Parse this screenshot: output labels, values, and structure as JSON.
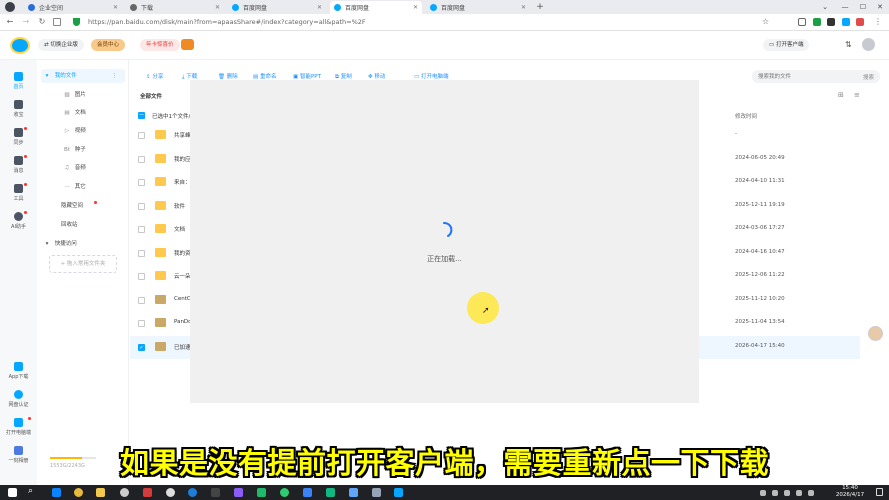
{
  "browser": {
    "tabs": [
      {
        "label": "企业空间",
        "color": "#2b6cd6",
        "active": false
      },
      {
        "label": "下载",
        "color": "#555555",
        "active": false
      },
      {
        "label": "百度网盘",
        "color": "#06a7ff",
        "active": false
      },
      {
        "label": "百度网盘",
        "color": "#06a7ff",
        "active": true
      },
      {
        "label": "百度网盘",
        "color": "#06a7ff",
        "active": false
      }
    ],
    "url": "https://pan.baidu.com/disk/main?from=apaasShare#/index?category=all&path=%2F"
  },
  "header": {
    "switch_enterprise": "切换企业版",
    "member_center": "会员中心",
    "promo": "年卡惊喜价",
    "open_client": "打开客户端"
  },
  "rail": {
    "items": [
      "首页",
      "收宝",
      "同步",
      "消息",
      "工具",
      "AI助手"
    ],
    "bottom": [
      "App下载",
      "网盘认证",
      "打开电脑端",
      "一刻相册"
    ]
  },
  "sidenav": {
    "my_files": "我的文件",
    "categories": [
      {
        "icon": "▨",
        "label": "图片"
      },
      {
        "icon": "▤",
        "label": "文档"
      },
      {
        "icon": "▷",
        "label": "视频"
      },
      {
        "icon": "Bt",
        "label": "种子"
      },
      {
        "icon": "♫",
        "label": "音频"
      },
      {
        "icon": "···",
        "label": "其它"
      }
    ],
    "hidden_space": "隐藏空间",
    "recycle_bin": "回收站",
    "quick_access": "快捷访问",
    "add_folder": "+ 拖入常用文件夹",
    "storage": "1553G/2243G"
  },
  "toolbar": {
    "share": "分享",
    "download": "下载",
    "delete": "删除",
    "rename": "重命名",
    "smart_ppt": "智能PPT",
    "copy": "复制",
    "move": "移动",
    "open_folder": "打开电脑端"
  },
  "search": {
    "placeholder": "搜索我的文件",
    "button": "搜索"
  },
  "files": {
    "breadcrumb": "全部文件",
    "selected_info": "已选中1个文件/",
    "column_modified": "修改时间",
    "rows": [
      {
        "name": "共享峰",
        "time": "-",
        "kind": "folder",
        "checked": false
      },
      {
        "name": "我的应",
        "time": "2024-06-05 20:49",
        "kind": "folder",
        "checked": false
      },
      {
        "name": "来自：",
        "time": "2024-04-10 11:31",
        "kind": "folder",
        "checked": false
      },
      {
        "name": "软件",
        "time": "2025-12-11 19:19",
        "kind": "folder",
        "checked": false
      },
      {
        "name": "文档",
        "time": "2024-03-06 17:27",
        "kind": "folder",
        "checked": false
      },
      {
        "name": "我的资",
        "time": "2024-04-16 10:47",
        "kind": "folder",
        "checked": false
      },
      {
        "name": "云一朵",
        "time": "2025-12-06 11:22",
        "kind": "folder",
        "checked": false
      },
      {
        "name": "CentO",
        "time": "2025-11-12 10:20",
        "kind": "file",
        "checked": false
      },
      {
        "name": "PanDo",
        "time": "2025-11-04 13:54",
        "kind": "file",
        "checked": false
      },
      {
        "name": "已加速",
        "time": "2026-04-17 15:40",
        "kind": "file",
        "checked": true
      }
    ]
  },
  "loading": {
    "text": "正在加载..."
  },
  "subtitle": "如果是没有提前打开客户端，需要重新点一下下载",
  "taskbar": {
    "time": "15:40",
    "date": "2026/4/17"
  }
}
